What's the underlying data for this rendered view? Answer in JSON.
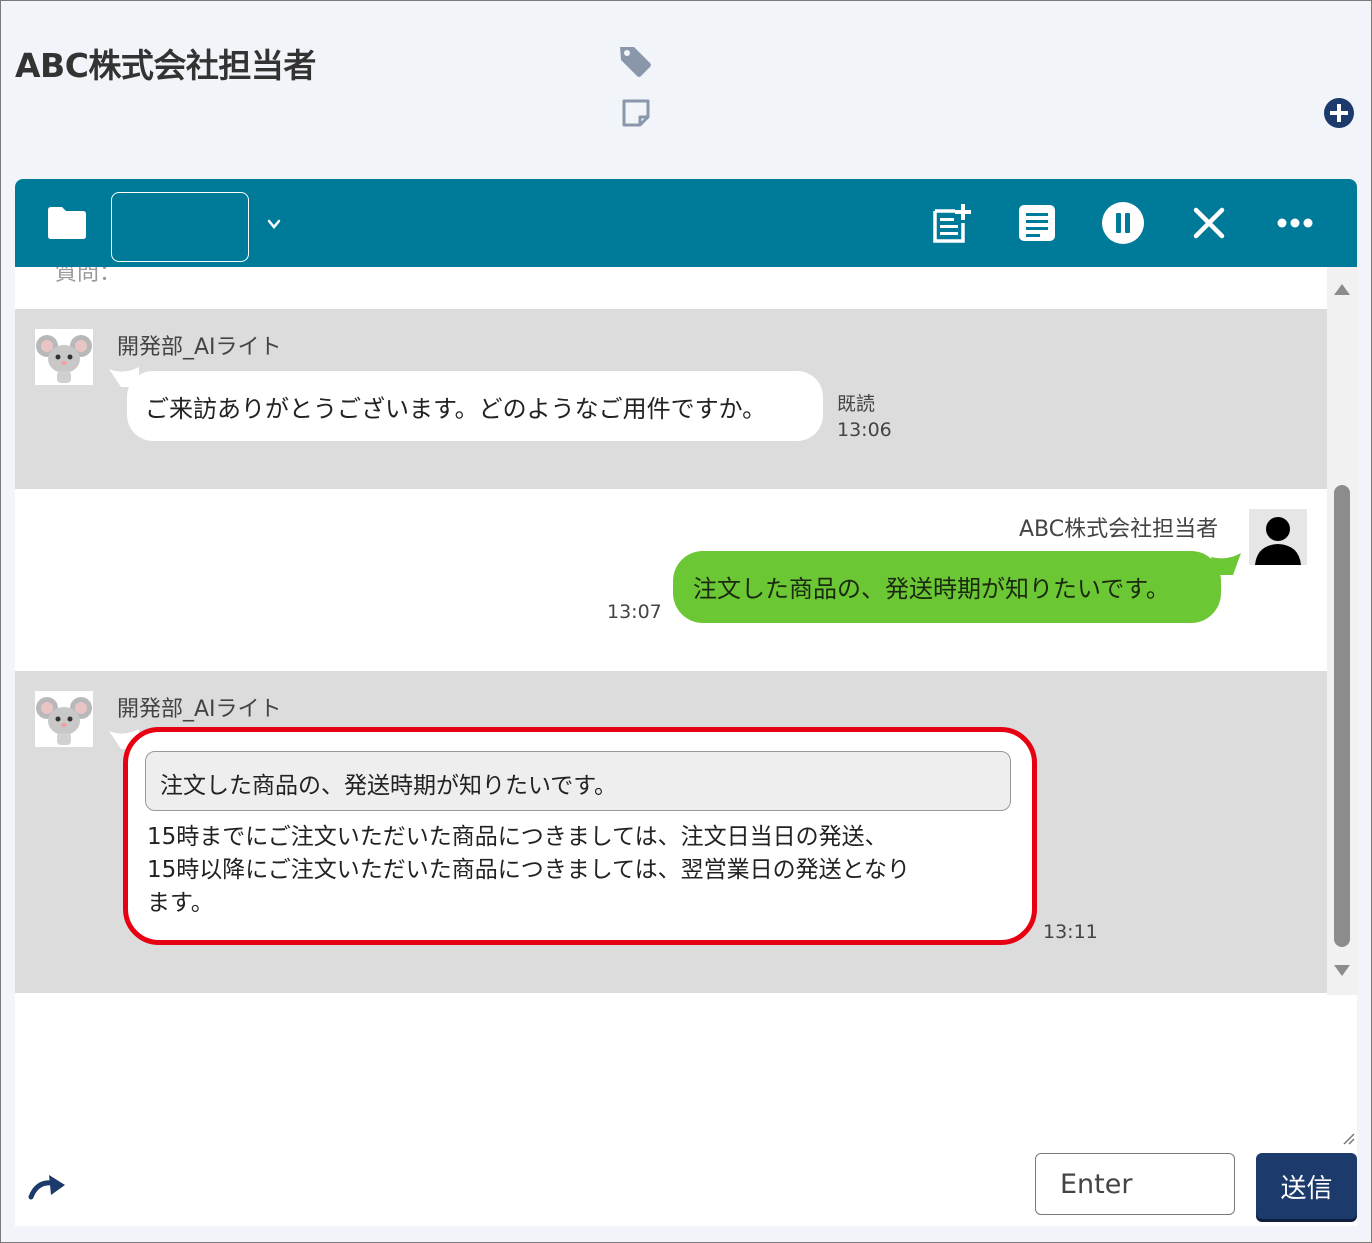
{
  "header": {
    "title": "ABC株式会社担当者",
    "tag_icon": "tag-icon",
    "note_icon": "sticky-note-icon",
    "add_icon": "plus-circle-icon"
  },
  "toolbar": {
    "background": "#007a99",
    "folder_icon": "folder-icon",
    "select_value": "",
    "icons": [
      "add-note-icon",
      "document-icon",
      "pause-icon",
      "close-icon",
      "more-icon"
    ]
  },
  "chat": {
    "partial_text": "質問：",
    "messages": [
      {
        "sender": "開発部_AIライト",
        "text": "ご来訪ありがとうございます。どのようなご用件ですか。",
        "read": "既読",
        "time": "13:06"
      },
      {
        "sender": "ABC株式会社担当者",
        "text": "注文した商品の、発送時期が知りたいです。",
        "time": "13:07"
      },
      {
        "sender": "開発部_AIライト",
        "quote": "注文した商品の、発送時期が知りたいです。",
        "answer_lines": [
          "15時までにご注文いただいた商品につきましては、注文日当日の発送、",
          "15時以降にご注文いただいた商品につきましては、翌営業日の発送となり",
          "ます。"
        ],
        "time": "13:11"
      }
    ]
  },
  "composer": {
    "input_placeholder": "Enter",
    "send_label": "送信",
    "send_color": "#1c3a6b"
  },
  "colors": {
    "highlight": "#e60012",
    "user_bubble": "#6cc734",
    "bot_row": "#dcdcdc"
  }
}
